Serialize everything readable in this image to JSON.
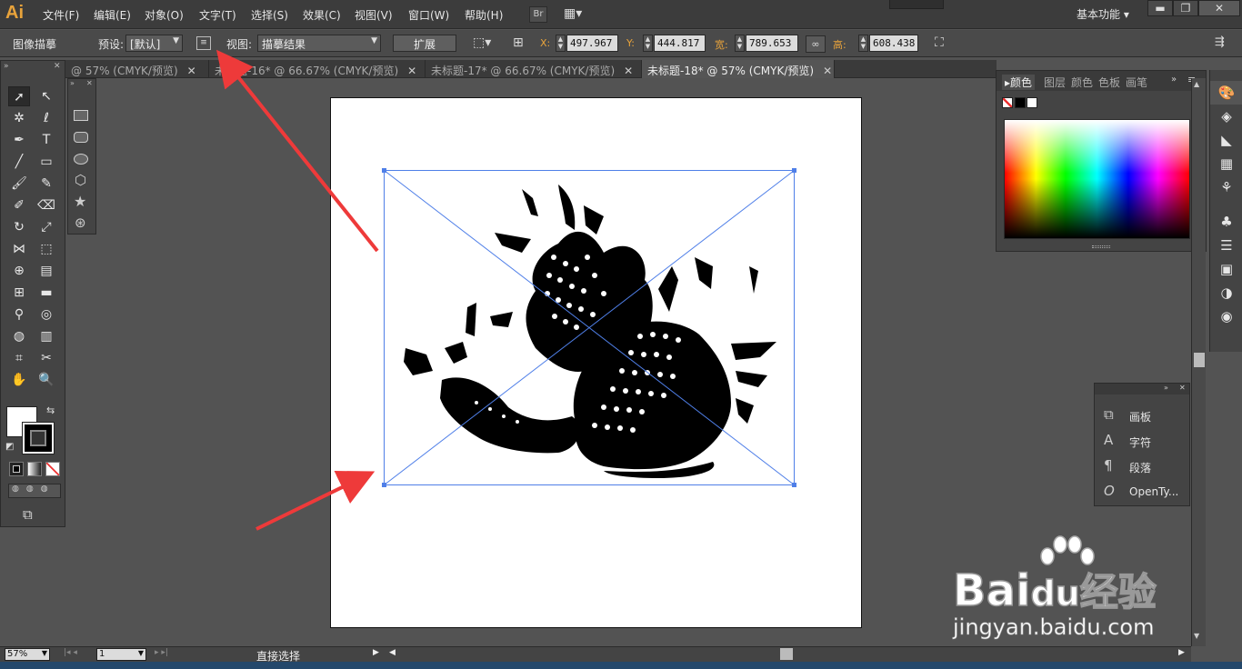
{
  "app": {
    "logo": "Ai",
    "workspace": "基本功能"
  },
  "menu": [
    "文件(F)",
    "编辑(E)",
    "对象(O)",
    "文字(T)",
    "选择(S)",
    "效果(C)",
    "视图(V)",
    "窗口(W)",
    "帮助(H)"
  ],
  "menubar_buttons": {
    "bridge": "Br"
  },
  "window_controls": {
    "minimize": "▬",
    "restore": "❐",
    "close": "✕"
  },
  "control": {
    "tool_name": "图像描摹",
    "preset_label": "预设:",
    "preset_value": "[默认]",
    "view_label": "视图:",
    "view_value": "描摹结果",
    "expand_button": "扩展",
    "x_label": "X:",
    "x_value": "497.967",
    "y_label": "Y:",
    "y_value": "444.817",
    "w_label": "宽:",
    "w_value": "789.653",
    "h_label": "高:",
    "h_value": "608.438"
  },
  "tabs": [
    {
      "label": "@ 57% (CMYK/预览)",
      "active": false
    },
    {
      "label": "未标题-16* @ 66.67% (CMYK/预览)",
      "active": false
    },
    {
      "label": "未标题-17* @ 66.67% (CMYK/预览)",
      "active": false
    },
    {
      "label": "未标题-18* @ 57% (CMYK/预览)",
      "active": true
    }
  ],
  "tab_close": "✕",
  "color_panel": {
    "tabs": [
      "颜色",
      "图层",
      "颜色",
      "色板",
      "画笔"
    ]
  },
  "type_panel": {
    "items": [
      {
        "icon": "artboard-icon",
        "glyph": "⧉",
        "label": "画板"
      },
      {
        "icon": "character-icon",
        "glyph": "A",
        "label": "字符"
      },
      {
        "icon": "paragraph-icon",
        "glyph": "¶",
        "label": "段落"
      },
      {
        "icon": "opentype-icon",
        "glyph": "O",
        "label": "OpenTy..."
      }
    ]
  },
  "status": {
    "zoom": "57%",
    "page": "1",
    "tool_label": "直接选择"
  },
  "watermark": {
    "text1": "Bai",
    "text2": "du",
    "text3": "经验",
    "url": "jingyan.baidu.com"
  },
  "colors": {
    "accent": "#e8a33b",
    "selection": "#4f7fe8",
    "annotation_arrow": "#ee3a3a"
  }
}
